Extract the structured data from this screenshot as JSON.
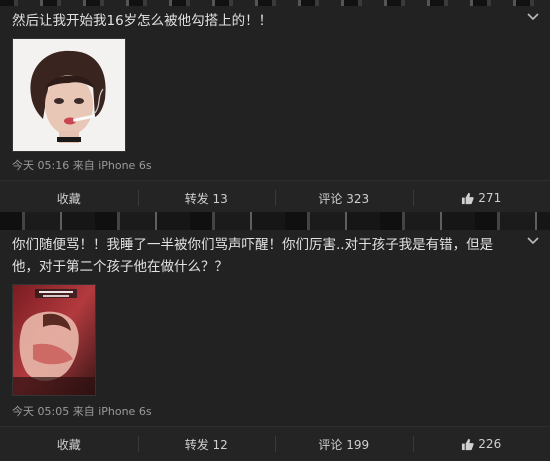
{
  "posts": [
    {
      "text": "然后让我开始我16岁怎么被他勾搭上的！！",
      "meta": "今天 05:16 来自 iPhone 6s",
      "actions": {
        "favorite": "收藏",
        "repost": "转发 13",
        "comment": "评论 323",
        "like": "271"
      }
    },
    {
      "text": "你们随便骂！！我睡了一半被你们骂声吓醒！你们厉害..对于孩子我是有错，但是他，对于第二个孩子他在做什么？？",
      "meta": "今天 05:05 来自 iPhone 6s",
      "actions": {
        "favorite": "收藏",
        "repost": "转发 12",
        "comment": "评论 199",
        "like": "226"
      }
    }
  ],
  "icons": {
    "menu": "chevron-down-icon",
    "like": "thumbs-up-icon"
  },
  "colors": {
    "background": "#1e1e1e",
    "text": "#e2e2e2",
    "muted": "#9a9a9a"
  }
}
